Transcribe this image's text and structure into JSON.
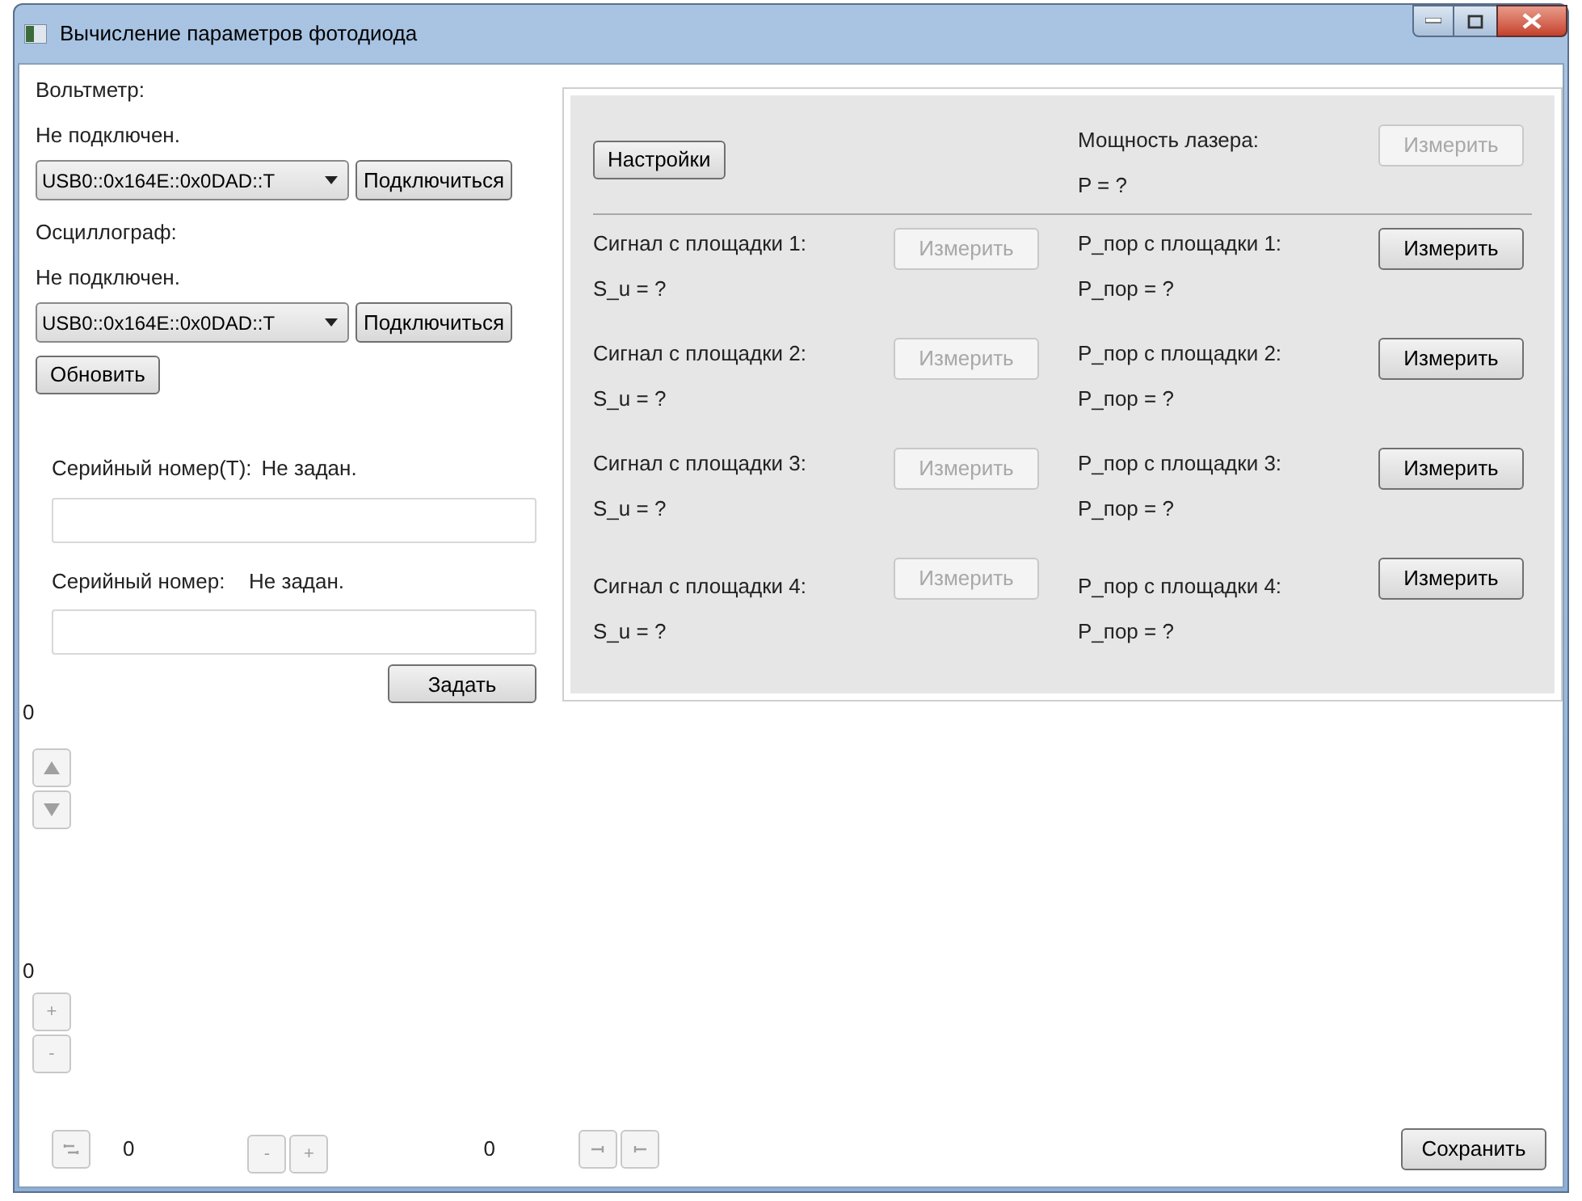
{
  "window": {
    "title": "Вычисление параметров фотодиода"
  },
  "voltmeter": {
    "label": "Вольтметр:",
    "status": "Не подключен.",
    "device": "USB0::0x164E::0x0DAD::T",
    "connect_button": "Подключиться"
  },
  "oscilloscope": {
    "label": "Осциллограф:",
    "status": "Не подключен.",
    "device": "USB0::0x164E::0x0DAD::T",
    "connect_button": "Подключиться"
  },
  "refresh_button": "Обновить",
  "serials": [
    {
      "label": "Серийный номер(T):",
      "status": "Не задан."
    },
    {
      "label": "Серийный номер:",
      "status": "Не задан."
    }
  ],
  "set_button": "Задать",
  "vertical_scroll": {
    "value": "0",
    "disabled": true
  },
  "zoom": {
    "value": "0",
    "buttons": [
      {
        "label": "+",
        "disabled": true
      },
      {
        "label": "-",
        "disabled": true
      }
    ]
  },
  "bottom_bar": {
    "swap_disabled": true,
    "value_1": "0",
    "buttons": [
      {
        "label": "-",
        "disabled": true
      },
      {
        "label": "+",
        "disabled": true
      }
    ],
    "value_2": "0",
    "arrows_disabled": true,
    "save_button": "Сохранить"
  },
  "panel": {
    "settings_button": "Настройки",
    "laser": {
      "label": "Мощность лазера:",
      "reading": "P = ?",
      "button": {
        "label": "Измерить",
        "disabled": true
      }
    },
    "rows": [
      {
        "signal_label": "Сигнал с площадки 1:",
        "signal_reading": "S_u = ?",
        "signal_button": {
          "label": "Измерить",
          "disabled": true
        },
        "threshold_label": "P_пор с площадки 1:",
        "threshold_reading": "P_пор = ?",
        "threshold_button": {
          "label": "Измерить",
          "disabled": false
        }
      },
      {
        "signal_label": "Сигнал с площадки 2:",
        "signal_reading": "S_u = ?",
        "signal_button": {
          "label": "Измерить",
          "disabled": true
        },
        "threshold_label": "P_пор с площадки 2:",
        "threshold_reading": "P_пор = ?",
        "threshold_button": {
          "label": "Измерить",
          "disabled": false
        }
      },
      {
        "signal_label": "Сигнал с площадки 3:",
        "signal_reading": "S_u = ?",
        "signal_button": {
          "label": "Измерить",
          "disabled": true
        },
        "threshold_label": "P_пор с площадки 3:",
        "threshold_reading": "P_пор = ?",
        "threshold_button": {
          "label": "Измерить",
          "disabled": false
        }
      },
      {
        "signal_label": "Сигнал с площадки 4:",
        "signal_reading": "S_u = ?",
        "signal_button": {
          "label": "Измерить",
          "disabled": true
        },
        "threshold_label": "P_пор с площадки 4:",
        "threshold_reading": "P_пор = ?",
        "threshold_button": {
          "label": "Измерить",
          "disabled": false
        }
      }
    ]
  }
}
